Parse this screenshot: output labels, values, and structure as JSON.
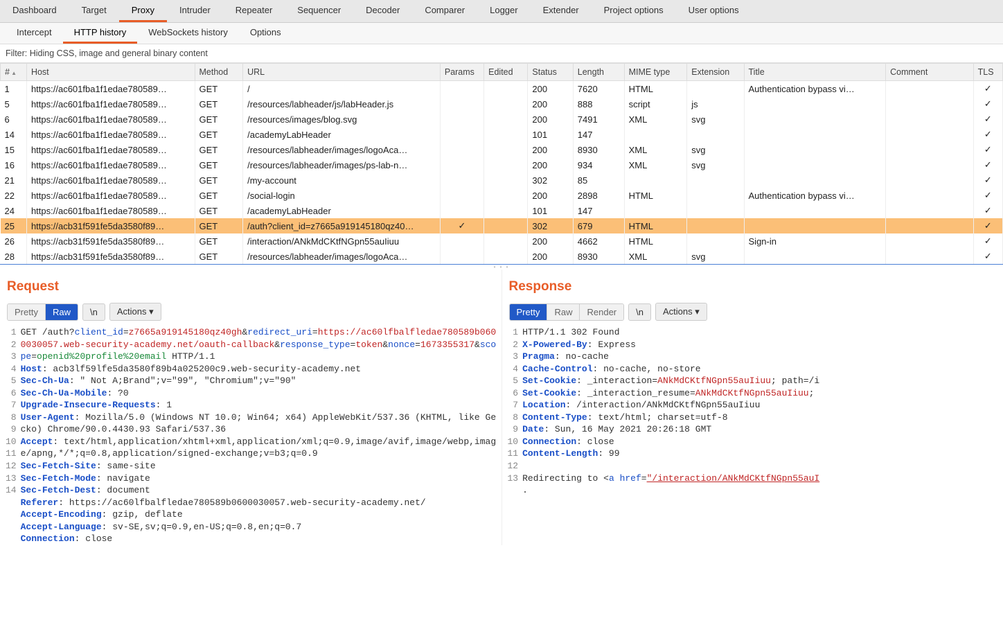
{
  "topTabs": [
    "Dashboard",
    "Target",
    "Proxy",
    "Intruder",
    "Repeater",
    "Sequencer",
    "Decoder",
    "Comparer",
    "Logger",
    "Extender",
    "Project options",
    "User options"
  ],
  "topActiveIndex": 2,
  "subTabs": [
    "Intercept",
    "HTTP history",
    "WebSockets history",
    "Options"
  ],
  "subActiveIndex": 1,
  "filterText": "Filter: Hiding CSS, image and general binary content",
  "columns": [
    "#",
    "Host",
    "Method",
    "URL",
    "Params",
    "Edited",
    "Status",
    "Length",
    "MIME type",
    "Extension",
    "Title",
    "Comment",
    "TLS"
  ],
  "rows": [
    {
      "n": "1",
      "host": "https://ac601fba1f1edae780589…",
      "method": "GET",
      "url": "/",
      "params": "",
      "edited": "",
      "status": "200",
      "len": "7620",
      "mime": "HTML",
      "ext": "",
      "title": "Authentication bypass vi…",
      "comment": "",
      "tls": "✓"
    },
    {
      "n": "5",
      "host": "https://ac601fba1f1edae780589…",
      "method": "GET",
      "url": "/resources/labheader/js/labHeader.js",
      "params": "",
      "edited": "",
      "status": "200",
      "len": "888",
      "mime": "script",
      "ext": "js",
      "title": "",
      "comment": "",
      "tls": "✓"
    },
    {
      "n": "6",
      "host": "https://ac601fba1f1edae780589…",
      "method": "GET",
      "url": "/resources/images/blog.svg",
      "params": "",
      "edited": "",
      "status": "200",
      "len": "7491",
      "mime": "XML",
      "ext": "svg",
      "title": "",
      "comment": "",
      "tls": "✓"
    },
    {
      "n": "14",
      "host": "https://ac601fba1f1edae780589…",
      "method": "GET",
      "url": "/academyLabHeader",
      "params": "",
      "edited": "",
      "status": "101",
      "len": "147",
      "mime": "",
      "ext": "",
      "title": "",
      "comment": "",
      "tls": "✓"
    },
    {
      "n": "15",
      "host": "https://ac601fba1f1edae780589…",
      "method": "GET",
      "url": "/resources/labheader/images/logoAca…",
      "params": "",
      "edited": "",
      "status": "200",
      "len": "8930",
      "mime": "XML",
      "ext": "svg",
      "title": "",
      "comment": "",
      "tls": "✓"
    },
    {
      "n": "16",
      "host": "https://ac601fba1f1edae780589…",
      "method": "GET",
      "url": "/resources/labheader/images/ps-lab-n…",
      "params": "",
      "edited": "",
      "status": "200",
      "len": "934",
      "mime": "XML",
      "ext": "svg",
      "title": "",
      "comment": "",
      "tls": "✓"
    },
    {
      "n": "21",
      "host": "https://ac601fba1f1edae780589…",
      "method": "GET",
      "url": "/my-account",
      "params": "",
      "edited": "",
      "status": "302",
      "len": "85",
      "mime": "",
      "ext": "",
      "title": "",
      "comment": "",
      "tls": "✓"
    },
    {
      "n": "22",
      "host": "https://ac601fba1f1edae780589…",
      "method": "GET",
      "url": "/social-login",
      "params": "",
      "edited": "",
      "status": "200",
      "len": "2898",
      "mime": "HTML",
      "ext": "",
      "title": "Authentication bypass vi…",
      "comment": "",
      "tls": "✓"
    },
    {
      "n": "24",
      "host": "https://ac601fba1f1edae780589…",
      "method": "GET",
      "url": "/academyLabHeader",
      "params": "",
      "edited": "",
      "status": "101",
      "len": "147",
      "mime": "",
      "ext": "",
      "title": "",
      "comment": "",
      "tls": "✓"
    },
    {
      "n": "25",
      "host": "https://acb31f591fe5da3580f89…",
      "method": "GET",
      "url": "/auth?client_id=z7665a919145180qz40…",
      "params": "✓",
      "edited": "",
      "status": "302",
      "len": "679",
      "mime": "HTML",
      "ext": "",
      "title": "",
      "comment": "",
      "tls": "✓",
      "selected": true
    },
    {
      "n": "26",
      "host": "https://acb31f591fe5da3580f89…",
      "method": "GET",
      "url": "/interaction/ANkMdCKtfNGpn55auIiuu",
      "params": "",
      "edited": "",
      "status": "200",
      "len": "4662",
      "mime": "HTML",
      "ext": "",
      "title": "Sign-in",
      "comment": "",
      "tls": "✓"
    },
    {
      "n": "28",
      "host": "https://acb31f591fe5da3580f89…",
      "method": "GET",
      "url": "/resources/labheader/images/logoAca…",
      "params": "",
      "edited": "",
      "status": "200",
      "len": "8930",
      "mime": "XML",
      "ext": "svg",
      "title": "",
      "comment": "",
      "tls": "✓"
    }
  ],
  "request": {
    "title": "Request",
    "views": [
      "Pretty",
      "Raw"
    ],
    "viewActive": 1,
    "btnN": "\\n",
    "btnActions": "Actions",
    "lines": [
      {
        "n": "1",
        "html": "GET /auth?<span class='p1'>client_id</span>=<span class='pv'>z7665a919145180qz40gh</span>&amp;<span class='p1'>redirect_uri</span>=<span class='pv'>https://ac60lfbalfledae780589b0600030057.web-security-academy.net/oauth-callback</span>&amp;<span class='p1'>response_type</span>=<span class='pv'>token</span>&amp;<span class='p1'>nonce</span>=<span class='pv'>1673355317</span>&amp;<span class='p1'>scope</span>=<span class='grn'>openid%20profile%20email</span> HTTP/1.1"
      },
      {
        "n": "2",
        "html": "<span class='kw'>Host</span>: acb3lf59lfe5da3580f89b4a025200c9.web-security-academy.net"
      },
      {
        "n": "3",
        "html": "<span class='kw'>Sec-Ch-Ua</span>: \" Not A;Brand\";v=\"99\", \"Chromium\";v=\"90\""
      },
      {
        "n": "4",
        "html": "<span class='kw'>Sec-Ch-Ua-Mobile</span>: ?0"
      },
      {
        "n": "5",
        "html": "<span class='kw'>Upgrade-Insecure-Requests</span>: 1"
      },
      {
        "n": "6",
        "html": "<span class='kw'>User-Agent</span>: Mozilla/5.0 (Windows NT 10.0; Win64; x64) AppleWebKit/537.36 (KHTML, like Gecko) Chrome/90.0.4430.93 Safari/537.36"
      },
      {
        "n": "7",
        "html": "<span class='kw'>Accept</span>: text/html,application/xhtml+xml,application/xml;q=0.9,image/avif,image/webp,image/apng,*/*;q=0.8,application/signed-exchange;v=b3;q=0.9"
      },
      {
        "n": "8",
        "html": "<span class='kw'>Sec-Fetch-Site</span>: same-site"
      },
      {
        "n": "9",
        "html": "<span class='kw'>Sec-Fetch-Mode</span>: navigate"
      },
      {
        "n": "10",
        "html": "<span class='kw'>Sec-Fetch-Dest</span>: document"
      },
      {
        "n": "11",
        "html": "<span class='kw'>Referer</span>: https://ac60lfbalfledae780589b0600030057.web-security-academy.net/"
      },
      {
        "n": "12",
        "html": "<span class='kw'>Accept-Encoding</span>: gzip, deflate"
      },
      {
        "n": "13",
        "html": "<span class='kw'>Accept-Language</span>: sv-SE,sv;q=0.9,en-US;q=0.8,en;q=0.7"
      },
      {
        "n": "14",
        "html": "<span class='kw'>Connection</span>: close"
      }
    ]
  },
  "response": {
    "title": "Response",
    "views": [
      "Pretty",
      "Raw",
      "Render"
    ],
    "viewActive": 0,
    "btnN": "\\n",
    "btnActions": "Actions",
    "lines": [
      {
        "n": "1",
        "html": "HTTP/1.1 302 Found"
      },
      {
        "n": "2",
        "html": "<span class='kw'>X-Powered-By</span>: Express"
      },
      {
        "n": "3",
        "html": "<span class='kw'>Pragma</span>: no-cache"
      },
      {
        "n": "4",
        "html": "<span class='kw'>Cache-Control</span>: no-cache, no-store"
      },
      {
        "n": "5",
        "html": "<span class='kw'>Set-Cookie</span>: _interaction=<span class='pv'>ANkMdCKtfNGpn55auIiuu</span>; path=/i"
      },
      {
        "n": "6",
        "html": "<span class='kw'>Set-Cookie</span>: _interaction_resume=<span class='pv'>ANkMdCKtfNGpn55auIiuu</span>;"
      },
      {
        "n": "7",
        "html": "<span class='kw'>Location</span>: /interaction/ANkMdCKtfNGpn55auIiuu"
      },
      {
        "n": "8",
        "html": "<span class='kw'>Content-Type</span>: text/html; charset=utf-8"
      },
      {
        "n": "9",
        "html": "<span class='kw'>Date</span>: Sun, 16 May 2021 20:26:18 GMT"
      },
      {
        "n": "10",
        "html": "<span class='kw'>Connection</span>: close"
      },
      {
        "n": "11",
        "html": "<span class='kw'>Content-Length</span>: 99"
      },
      {
        "n": "12",
        "html": ""
      },
      {
        "n": "13",
        "html": "Redirecting to &lt;<span class='p1'>a</span> <span class='p1'>href</span>=<span class='lnk'>\"/interaction/ANkMdCKtfNGpn55auI</span>"
      },
      {
        "n": "",
        "html": "."
      }
    ]
  }
}
